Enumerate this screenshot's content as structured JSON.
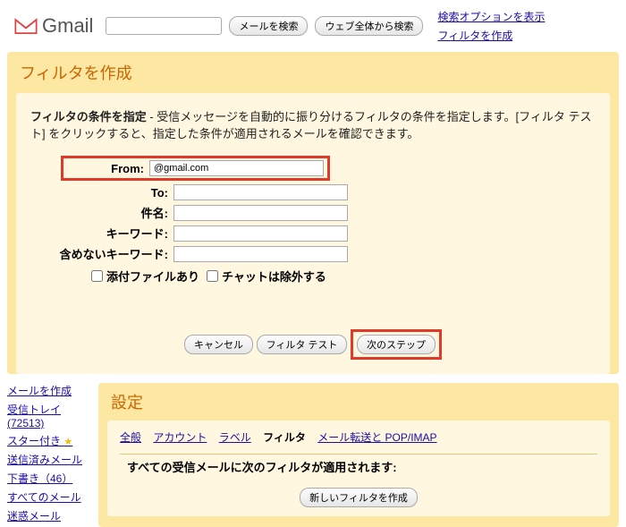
{
  "header": {
    "logo_text": "Gmail",
    "search_btn": "メールを検索",
    "web_search_btn": "ウェブ全体から検索",
    "link_options": "検索オプションを表示",
    "link_filter": "フィルタを作成"
  },
  "panel": {
    "title": "フィルタを作成",
    "desc_bold": "フィルタの条件を指定",
    "desc_rest": " - 受信メッセージを自動的に振り分けるフィルタの条件を指定します。[フィルタ テスト] をクリックすると、指定した条件が適用されるメールを確認できます。",
    "labels": {
      "from": "From:",
      "to": "To:",
      "subject": "件名:",
      "keyword": "キーワード:",
      "exclude": "含めないキーワード:"
    },
    "from_value": "@gmail.com",
    "cb_attach": "添付ファイルあり",
    "cb_chat": "チャットは除外する",
    "btn_cancel": "キャンセル",
    "btn_test": "フィルタ テスト",
    "btn_next": "次のステップ"
  },
  "sidebar": {
    "compose": "メールを作成",
    "inbox": "受信トレイ",
    "inbox_count": "(72513)",
    "starred": "スター付き",
    "sent": "送信済みメール",
    "drafts": "下書き（46）",
    "all": "すべてのメール",
    "spam": "迷惑メール"
  },
  "settings": {
    "title": "設定",
    "tabs": {
      "general": "全般",
      "account": "アカウント",
      "label": "ラベル",
      "filter": "フィルタ",
      "forward": "メール転送と POP/IMAP"
    },
    "applied": "すべての受信メールに次のフィルタが適用されます:",
    "new_filter_btn": "新しいフィルタを作成"
  }
}
